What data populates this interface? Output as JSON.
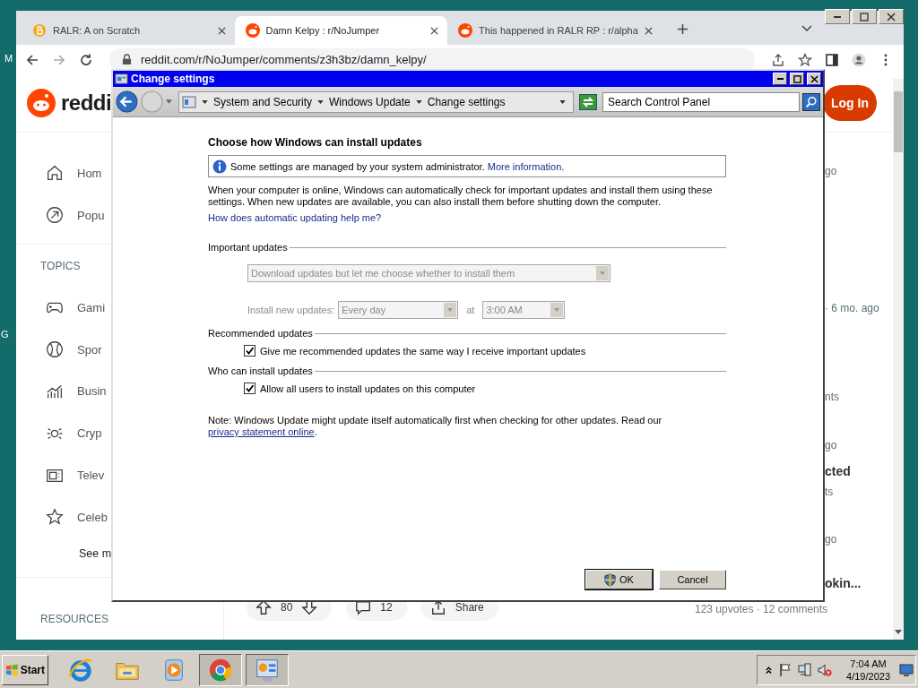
{
  "desktop_labels": [
    "M",
    "G"
  ],
  "browser": {
    "tabs": [
      {
        "title": "RALR: A on Scratch",
        "selected": false
      },
      {
        "title": "Damn Kelpy : r/NoJumper",
        "selected": true
      },
      {
        "title": "This happened in RALR RP : r/alpha",
        "selected": false
      }
    ],
    "url": "reddit.com/r/NoJumper/comments/z3h3bz/damn_kelpy/",
    "header": {
      "logo": "reddi",
      "login": "Log In"
    },
    "sidebar": {
      "items": [
        "Hom",
        "Popu"
      ],
      "topics_heading": "TOPICS",
      "topics": [
        "Gami",
        "Spor",
        "Busin",
        "Cryp",
        "Telev",
        "Celeb"
      ],
      "see_more": "See m",
      "resources_heading": "RESOURCES"
    },
    "post_actions": {
      "score": "80",
      "comments": "12",
      "share": "Share"
    },
    "right_column": [
      {
        "kind": "meta",
        "text": "go"
      },
      {
        "kind": "meta",
        "text": "· 6 mo. ago"
      },
      {
        "kind": "meta",
        "text": "nts"
      },
      {
        "kind": "meta",
        "text": "go"
      },
      {
        "kind": "title",
        "text": "cted"
      },
      {
        "kind": "meta",
        "text": "ts"
      },
      {
        "kind": "meta",
        "text": "go"
      },
      {
        "kind": "title",
        "text": "okin..."
      }
    ],
    "right_footer": "123 upvotes · 12 comments"
  },
  "dialog": {
    "title": "Change settings",
    "breadcrumb": [
      "System and Security",
      "Windows Update",
      "Change settings"
    ],
    "search": {
      "placeholder": "Search Control Panel"
    },
    "heading": "Choose how Windows can install updates",
    "info": {
      "text": "Some settings are managed by your system administrator.",
      "link": "More information."
    },
    "description": "When your computer is online, Windows can automatically check for important updates and install them using these settings. When new updates are available, you can also install them before shutting down the computer.",
    "help_link": "How does automatic updating help me?",
    "sections": [
      {
        "title": "Important updates",
        "kind": "schedule",
        "mode": {
          "value": "Download updates but let me choose whether to install them",
          "disabled": true
        },
        "install_label": "Install new updates:",
        "day": {
          "value": "Every day",
          "disabled": true
        },
        "at_label": "at",
        "time": {
          "value": "3:00 AM",
          "disabled": true
        }
      },
      {
        "title": "Recommended updates",
        "kind": "checkbox",
        "label": "Give me recommended updates the same way I receive important updates",
        "checked": true
      },
      {
        "title": "Who can install updates",
        "kind": "checkbox",
        "label": "Allow all users to install updates on this computer",
        "checked": true
      }
    ],
    "note": {
      "text": "Note: Windows Update might update itself automatically first when checking for other updates. Read our",
      "link": "privacy statement online",
      "end": "."
    },
    "buttons": [
      {
        "label": "OK",
        "kind": "shield"
      },
      {
        "label": "Cancel",
        "kind": "plain"
      }
    ]
  },
  "taskbar": {
    "start": "Start",
    "apps": [
      {
        "selected": false
      },
      {
        "selected": false
      },
      {
        "selected": false
      },
      {
        "selected": true
      },
      {
        "selected": true
      }
    ],
    "tray": {
      "time": "7:04 AM",
      "date": "4/19/2023"
    }
  }
}
